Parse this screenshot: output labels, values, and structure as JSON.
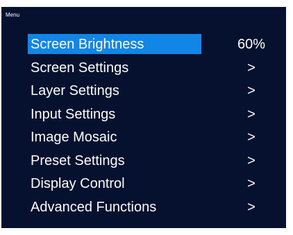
{
  "menu": {
    "title": "Menu",
    "items": [
      {
        "label": "Screen Brightness",
        "value": "60%"
      },
      {
        "label": "Screen Settings",
        "value": ">"
      },
      {
        "label": "Layer Settings",
        "value": ">"
      },
      {
        "label": "Input Settings",
        "value": ">"
      },
      {
        "label": "Image Mosaic",
        "value": ">"
      },
      {
        "label": "Preset Settings",
        "value": ">"
      },
      {
        "label": "Display Control",
        "value": ">"
      },
      {
        "label": "Advanced Functions",
        "value": ">"
      }
    ],
    "selected_index": 0
  },
  "colors": {
    "background": "#06112f",
    "highlight": "#1186e6",
    "text": "#ffffff"
  }
}
